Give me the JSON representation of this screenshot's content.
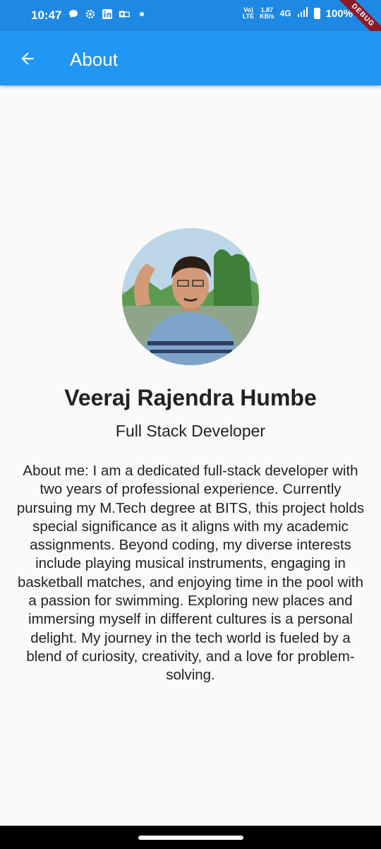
{
  "status_bar": {
    "time": "10:47",
    "data_speed": "1.87",
    "data_unit": "KB/s",
    "volte": "VoLTE",
    "network": "4G",
    "battery": "100%",
    "notification_icons": [
      "chat-icon",
      "settings-icon",
      "linkedin-icon",
      "outlook-icon"
    ]
  },
  "debug_banner": "DEBUG",
  "app_bar": {
    "title": "About",
    "back_icon": "arrow-back-icon",
    "color": "#2196f3"
  },
  "profile": {
    "name": "Veeraj Rajendra Humbe",
    "role": "Full Stack Developer",
    "about": "About me: I am a dedicated full-stack developer with two years of professional experience. Currently pursuing my M.Tech degree at BITS, this project holds special significance as it aligns with my academic assignments. Beyond coding, my diverse interests include playing musical instruments, engaging in basketball matches, and enjoying time in the pool with a passion for swimming. Exploring new places and immersing myself in different cultures is a personal delight. My journey in the tech world is fueled by a blend of curiosity, creativity, and a love for problem-solving."
  }
}
